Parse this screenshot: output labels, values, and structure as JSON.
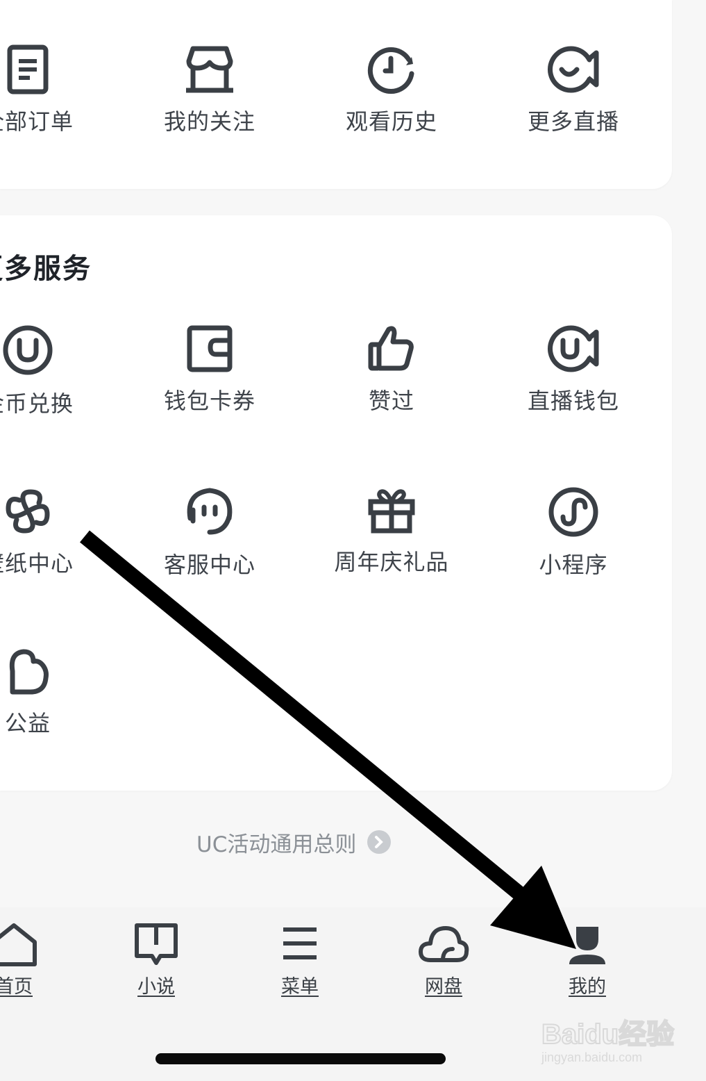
{
  "top_items": [
    {
      "label": "全部订单",
      "icon": "order-document-icon"
    },
    {
      "label": "我的关注",
      "icon": "store-follow-icon"
    },
    {
      "label": "观看历史",
      "icon": "history-clock-icon"
    },
    {
      "label": "更多直播",
      "icon": "live-camera-icon"
    }
  ],
  "services": {
    "title": "更多服务",
    "items": [
      {
        "label": "金币兑换",
        "icon": "coin-u-icon"
      },
      {
        "label": "钱包卡券",
        "icon": "wallet-icon"
      },
      {
        "label": "赞过",
        "icon": "thumbs-up-icon"
      },
      {
        "label": "直播钱包",
        "icon": "live-wallet-icon"
      },
      {
        "label": "壁纸中心",
        "icon": "wallpaper-swirl-icon"
      },
      {
        "label": "客服中心",
        "icon": "headset-icon"
      },
      {
        "label": "周年庆礼品",
        "icon": "gift-icon"
      },
      {
        "label": "小程序",
        "icon": "mini-program-icon"
      },
      {
        "label": "公益",
        "icon": "charity-heart-icon"
      }
    ]
  },
  "rules_link": {
    "label": "UC活动通用总则"
  },
  "tabbar": {
    "tabs": [
      {
        "label": "首页",
        "icon": "home-icon"
      },
      {
        "label": "小说",
        "icon": "book-icon"
      },
      {
        "label": "菜单",
        "icon": "menu-icon"
      },
      {
        "label": "网盘",
        "icon": "cloud-icon"
      },
      {
        "label": "我的",
        "icon": "user-icon",
        "active": true
      }
    ]
  },
  "watermark": {
    "brand": "Baidu经验",
    "url": "jingyan.baidu.com"
  },
  "colors": {
    "icon": "#3a3f45",
    "text": "#3e434a",
    "title": "#1f2329",
    "link": "#8b9096",
    "arrow": "#000000"
  }
}
